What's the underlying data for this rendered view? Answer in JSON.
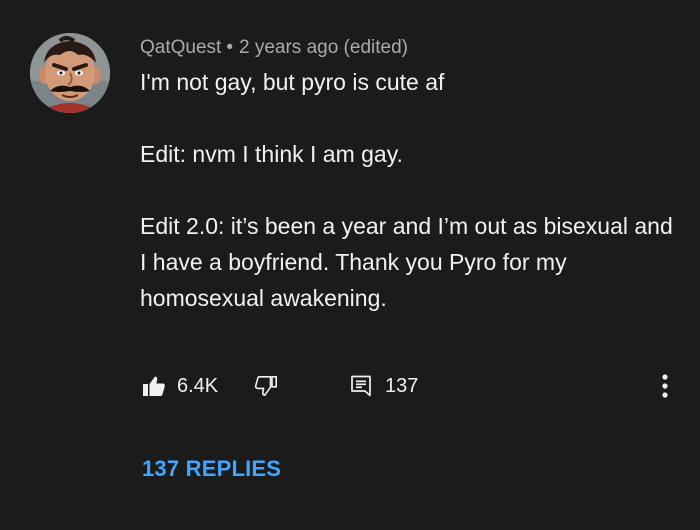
{
  "comment": {
    "author": "QatQuest",
    "separator": "•",
    "timestamp": "2 years ago (edited)",
    "paragraphs": [
      "I'm not gay, but pyro is cute af",
      "Edit: nvm I think I am gay.",
      "Edit 2.0: it’s been a year and I’m out as bisexual and I have a boyfriend. Thank you Pyro for my homosexual awakening."
    ],
    "like_count": "6.4K",
    "reply_count": "137",
    "replies_link": "137 REPLIES"
  },
  "icons": {
    "like": "thumbs-up-filled-icon",
    "dislike": "thumbs-down-outline-icon",
    "reply": "comment-icon",
    "more": "more-vertical-icon"
  },
  "colors": {
    "background": "#1b1b1b",
    "meta_text": "#aaaaaa",
    "body_text": "#f1f1f1",
    "link": "#3ea6ff"
  }
}
